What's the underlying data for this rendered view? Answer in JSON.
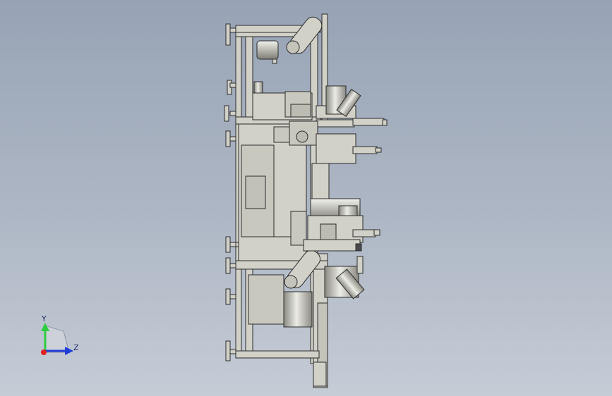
{
  "viewport": {
    "background_top": "#97a3b5",
    "background_bottom": "#c5ccd6",
    "model_fill": "#d2d1c8",
    "model_stroke": "#2b2b2b"
  },
  "triad": {
    "y_label": "Y",
    "z_label": "Z",
    "y_color": "#2ecc40",
    "z_color": "#1f3fd8",
    "x_color": "#e02020"
  }
}
